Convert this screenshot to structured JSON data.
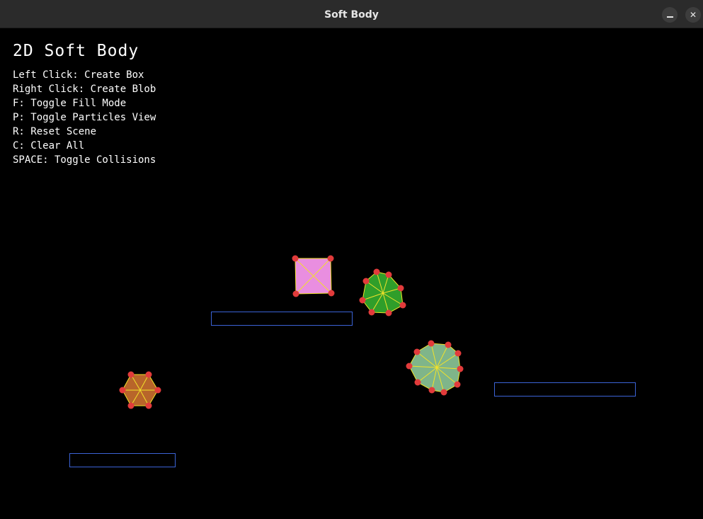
{
  "window": {
    "title": "Soft Body",
    "minimize_glyph": "–",
    "close_glyph": "✕"
  },
  "hud": {
    "heading": "2D Soft Body",
    "instructions": [
      "Left Click: Create Box",
      "Right Click: Create Blob",
      "F: Toggle Fill Mode",
      "P: Toggle Particles View",
      "R: Reset Scene",
      "C: Clear All",
      "SPACE: Toggle Collisions"
    ]
  },
  "colors": {
    "background": "#000000",
    "platform_outline": "#3b63d6",
    "particle": "#e23b3b",
    "spring": "#f2e22a",
    "box_fill": "#e98ee0",
    "blob_green_fill": "#2f9e2a",
    "blob_sage_fill": "#7fb58a",
    "blob_orange_fill": "#b8652a"
  },
  "icons": {
    "minimize": "minimize-icon",
    "close": "close-icon"
  }
}
